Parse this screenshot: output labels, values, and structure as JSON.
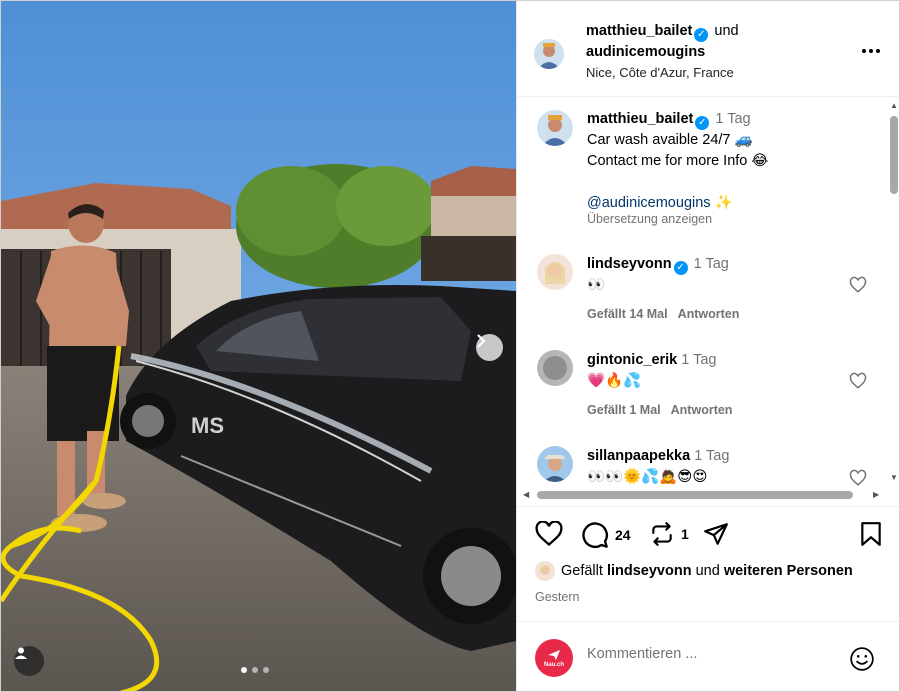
{
  "photo": {
    "carousel_dots": 3,
    "active_dot": 0,
    "next_icon": "chevron-right-icon",
    "tag_icon": "user-icon",
    "car_logo_text": "MS"
  },
  "header": {
    "user1": "matthieu_bailet",
    "joiner": "und",
    "user2": "audinicemougins",
    "location": "Nice, Côte d'Azur, France"
  },
  "caption": {
    "username": "matthieu_bailet",
    "time": "1 Tag",
    "line1": "Car wash avaible 24/7 🚙",
    "line2": "Contact me for more Info 😂",
    "mention": "@audinicemougins",
    "mention_emoji": "✨",
    "translate": "Übersetzung anzeigen"
  },
  "comments": [
    {
      "username": "lindseyvonn",
      "verified": true,
      "time": "1 Tag",
      "text": "👀",
      "likes": "Gefällt 14 Mal",
      "reply": "Antworten"
    },
    {
      "username": "gintonic_erik",
      "verified": false,
      "time": "1 Tag",
      "text": "💗🔥💦",
      "likes": "Gefällt 1 Mal",
      "reply": "Antworten"
    },
    {
      "username": "sillanpaapekka",
      "verified": false,
      "time": "1 Tag",
      "text": "👀👀🌞💦🙇😎😍"
    }
  ],
  "actions": {
    "comment_count": "24",
    "repost_count": "1",
    "likes_prefix": "Gefällt",
    "likes_user": "lindseyvonn",
    "likes_mid": "und",
    "likes_rest": "weiteren Personen",
    "date": "Gestern"
  },
  "comment_bar": {
    "avatar_label": "Nau.ch",
    "placeholder": "Kommentieren ..."
  },
  "colors": {
    "verified": "#0095f6",
    "link": "#00376b",
    "muted": "#737373",
    "sky": "#6fa9e0",
    "car": "#1c1c1e",
    "hose": "#f2d700"
  }
}
